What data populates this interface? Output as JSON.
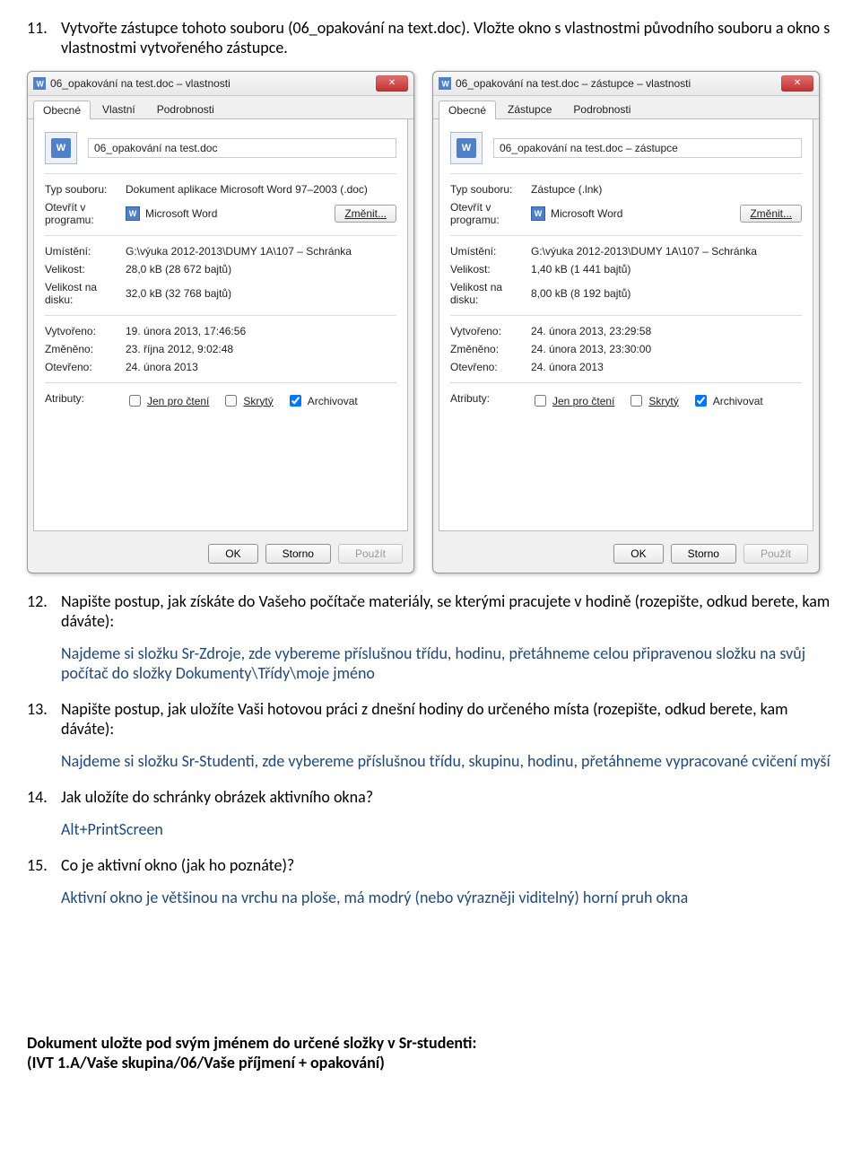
{
  "q11": {
    "num": "11.",
    "text": "Vytvořte zástupce tohoto souboru (06_opakování na text.doc). Vložte okno s vlastnostmi původního souboru a okno s vlastnostmi vytvořeného zástupce."
  },
  "q12": {
    "num": "12.",
    "text": "Napište postup, jak získáte do Vašeho počítače materiály, se kterými pracujete v hodině (rozepište, odkud berete, kam dáváte):",
    "answer": "Najdeme si složku Sr-Zdroje, zde vybereme příslušnou třídu, hodinu, přetáhneme celou připravenou složku na svůj počítač do složky Dokumenty\\Třídy\\moje jméno"
  },
  "q13": {
    "num": "13.",
    "text": "Napište postup, jak uložíte Vaši hotovou práci z dnešní hodiny do určeného místa (rozepište, odkud berete, kam dáváte):",
    "answer": "Najdeme si složku Sr-Studenti, zde vybereme příslušnou třídu, skupinu, hodinu, přetáhneme vypracované cvičení myší"
  },
  "q14": {
    "num": "14.",
    "text": "Jak uložíte do schránky obrázek aktivního okna?",
    "answer": "Alt+PrintScreen"
  },
  "q15": {
    "num": "15.",
    "text": "Co je aktivní okno (jak ho poznáte)?",
    "answer": "Aktivní okno je většinou na vrchu na ploše, má modrý (nebo výrazněji viditelný) horní pruh okna"
  },
  "footer": {
    "l1": "Dokument uložte pod svým jménem do určené složky v Sr-studenti:",
    "l2": "(IVT 1.A/Vaše skupina/06/Vaše příjmení + opakování)"
  },
  "dialog1": {
    "title": "06_opakování na test.doc – vlastnosti",
    "tabs": [
      "Obecné",
      "Vlastní",
      "Podrobnosti"
    ],
    "filename": "06_opakování na test.doc",
    "icon_letter": "W",
    "props": {
      "typ_l": "Typ souboru:",
      "typ_v": "Dokument aplikace Microsoft Word 97–2003 (.doc)",
      "otv_l": "Otevřít v programu:",
      "otv_v": "Microsoft Word",
      "zmenit": "Změnit...",
      "umist_l": "Umístění:",
      "umist_v": "G:\\výuka 2012-2013\\DUMY 1A\\107 – Schránka",
      "vel_l": "Velikost:",
      "vel_v": "28,0 kB (28 672 bajtů)",
      "veld_l": "Velikost na disku:",
      "veld_v": "32,0 kB (32 768 bajtů)",
      "vyt_l": "Vytvořeno:",
      "vyt_v": "19. února 2013, 17:46:56",
      "zm_l": "Změněno:",
      "zm_v": "23. října 2012, 9:02:48",
      "ot_l": "Otevřeno:",
      "ot_v": "24. února 2013",
      "atr_l": "Atributy:",
      "atr1": "Jen pro čtení",
      "atr2": "Skrytý",
      "atr3": "Archivovat"
    }
  },
  "dialog2": {
    "title": "06_opakování na test.doc – zástupce – vlastnosti",
    "tabs": [
      "Obecné",
      "Zástupce",
      "Podrobnosti"
    ],
    "filename": "06_opakování na test.doc – zástupce",
    "icon_letter": "W",
    "props": {
      "typ_l": "Typ souboru:",
      "typ_v": "Zástupce (.lnk)",
      "otv_l": "Otevřít v programu:",
      "otv_v": "Microsoft Word",
      "zmenit": "Změnit...",
      "umist_l": "Umístění:",
      "umist_v": "G:\\výuka 2012-2013\\DUMY 1A\\107 – Schránka",
      "vel_l": "Velikost:",
      "vel_v": "1,40 kB (1 441 bajtů)",
      "veld_l": "Velikost na disku:",
      "veld_v": "8,00 kB (8 192 bajtů)",
      "vyt_l": "Vytvořeno:",
      "vyt_v": "24. února 2013, 23:29:58",
      "zm_l": "Změněno:",
      "zm_v": "24. února 2013, 23:30:00",
      "ot_l": "Otevřeno:",
      "ot_v": "24. února 2013",
      "atr_l": "Atributy:",
      "atr1": "Jen pro čtení",
      "atr2": "Skrytý",
      "atr3": "Archivovat"
    }
  },
  "buttons": {
    "ok": "OK",
    "storno": "Storno",
    "pouzit": "Použít"
  }
}
